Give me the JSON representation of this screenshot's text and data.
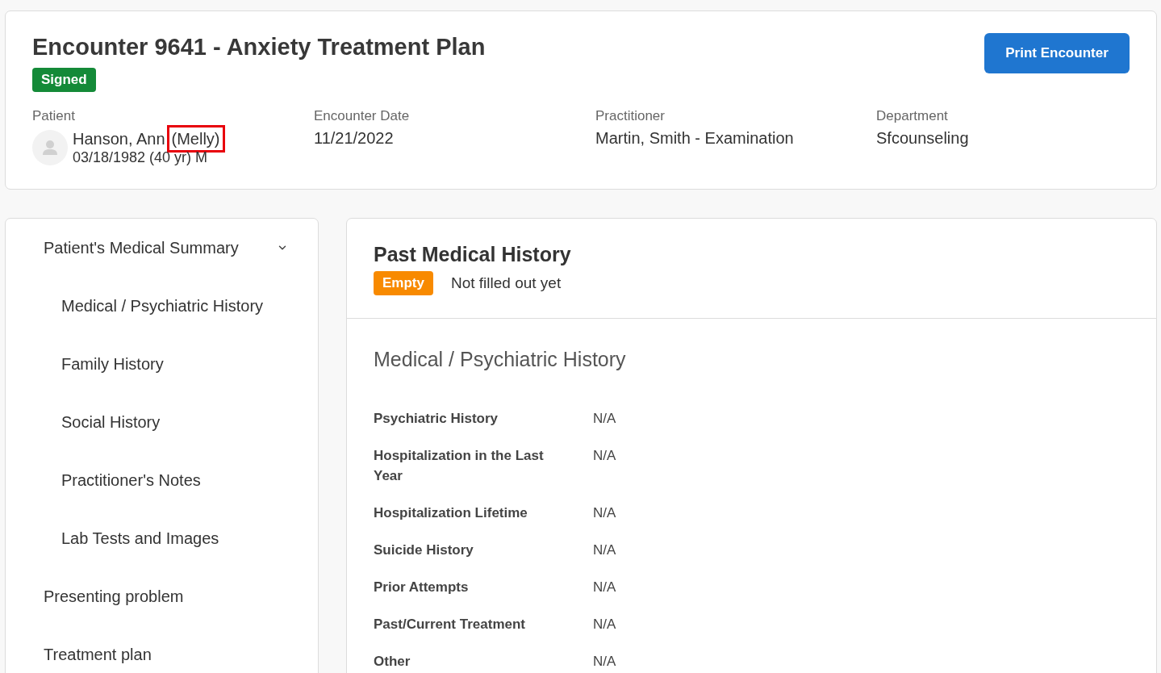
{
  "encounter": {
    "title": "Encounter 9641 - Anxiety Treatment Plan",
    "status": {
      "label": "Signed",
      "kind": "signed"
    },
    "print_button": "Print Encounter",
    "patient": {
      "label": "Patient",
      "name": "Hanson, Ann",
      "nickname": "(Melly)",
      "nickname_highlighted": true,
      "details": "03/18/1982 (40 yr) M"
    },
    "fields": [
      {
        "label": "Encounter Date",
        "value": "11/21/2022"
      },
      {
        "label": "Practitioner",
        "value": "Martin, Smith - Examination"
      },
      {
        "label": "Department",
        "value": "Sfcounseling"
      }
    ]
  },
  "sidebar": {
    "items": [
      {
        "label": "Patient's Medical Summary",
        "expanded": true,
        "children": [
          {
            "label": "Medical / Psychiatric History"
          },
          {
            "label": "Family History"
          },
          {
            "label": "Social History"
          },
          {
            "label": "Practitioner's Notes"
          },
          {
            "label": "Lab Tests and Images"
          }
        ]
      },
      {
        "label": "Presenting problem"
      },
      {
        "label": "Treatment plan"
      }
    ]
  },
  "main": {
    "title": "Past Medical History",
    "status": {
      "label": "Empty",
      "kind": "empty"
    },
    "status_note": "Not filled out yet",
    "section": {
      "title": "Medical / Psychiatric History",
      "rows": [
        {
          "label": "Psychiatric History",
          "value": "N/A"
        },
        {
          "label": "Hospitalization in the Last Year",
          "value": "N/A"
        },
        {
          "label": "Hospitalization Lifetime",
          "value": "N/A"
        },
        {
          "label": "Suicide History",
          "value": "N/A"
        },
        {
          "label": "Prior Attempts",
          "value": "N/A"
        },
        {
          "label": "Past/Current Treatment",
          "value": "N/A"
        },
        {
          "label": "Other",
          "value": "N/A"
        }
      ]
    }
  }
}
